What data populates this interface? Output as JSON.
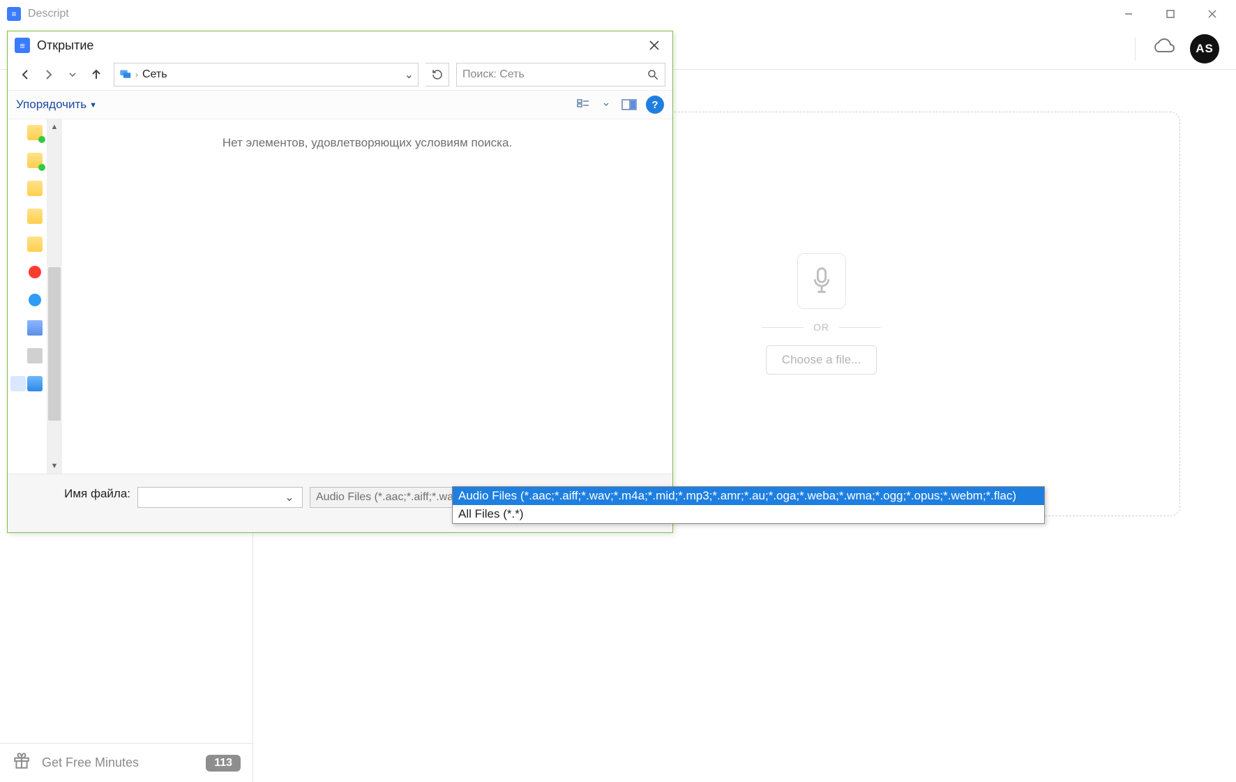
{
  "app": {
    "title": "Descript",
    "avatar": "AS"
  },
  "dropzone": {
    "or": "OR",
    "choose": "Choose a file..."
  },
  "footer": {
    "minutes": "Get Free Minutes",
    "badge": "113"
  },
  "dialog": {
    "title": "Открытие",
    "location": "Сеть",
    "search_placeholder": "Поиск: Сеть",
    "organize": "Упорядочить",
    "empty": "Нет элементов, удовлетворяющих условиям поиска.",
    "filename_label": "Имя файла:",
    "filename_value": "",
    "filetype_selected": "Audio Files (*.aac;*.aiff;*.wav;*.m4a;*.mid;*.mp3;*.amr;*.au;*.oga;*.weba;*.wma;*.ogg;*.opus;*.webm;*.flac)",
    "filetype_options": [
      "Audio Files (*.aac;*.aiff;*.wav;*.m4a;*.mid;*.mp3;*.amr;*.au;*.oga;*.weba;*.wma;*.ogg;*.opus;*.webm;*.flac)",
      "All Files (*.*)"
    ]
  }
}
